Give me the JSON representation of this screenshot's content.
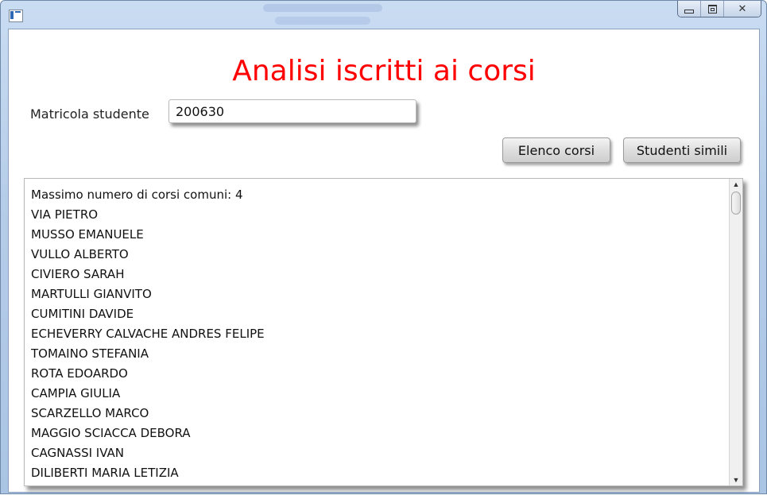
{
  "window": {
    "icon": "app-window-icon",
    "minimize_icon": "minimize-icon",
    "maximize_icon": "maximize-icon",
    "close_glyph": "✕"
  },
  "main": {
    "title": "Analisi iscritti ai corsi",
    "title_color": "#ff0000",
    "matricola_label": "Matricola studente",
    "matricola_value": "200630",
    "buttons": {
      "elenco_corsi": "Elenco corsi",
      "studenti_simili": "Studenti simili"
    },
    "output_lines": [
      "Massimo numero di corsi comuni: 4",
      "VIA PIETRO",
      "MUSSO EMANUELE",
      "VULLO ALBERTO",
      "CIVIERO SARAH",
      "MARTULLI GIANVITO",
      "CUMITINI DAVIDE",
      "ECHEVERRY CALVACHE ANDRES FELIPE",
      "TOMAINO STEFANIA",
      "ROTA EDOARDO",
      "CAMPIA GIULIA",
      "SCARZELLO MARCO",
      "MAGGIO SCIACCA DEBORA",
      "CAGNASSI IVAN",
      "DILIBERTI MARIA LETIZIA"
    ]
  }
}
